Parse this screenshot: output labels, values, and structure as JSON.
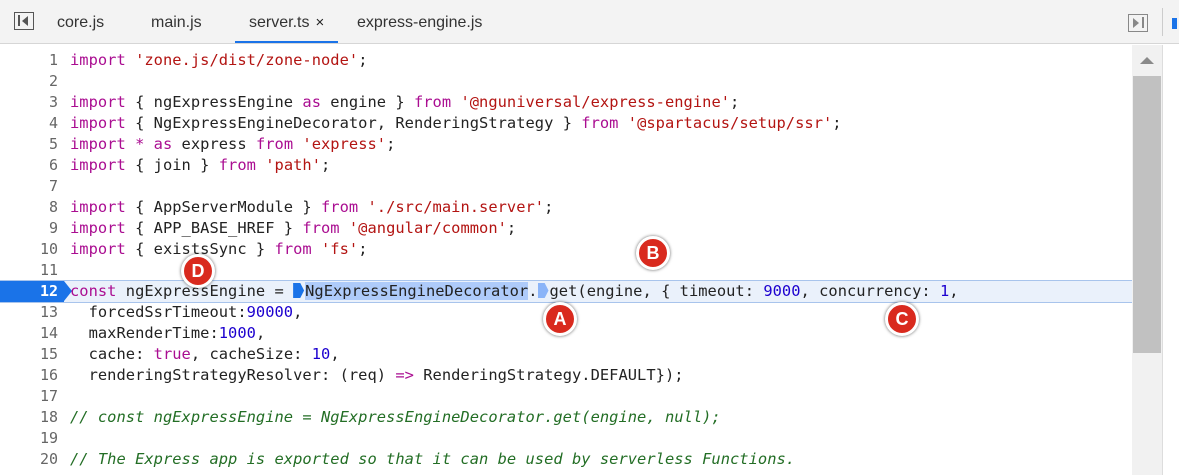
{
  "tabs": [
    {
      "label": "core.js"
    },
    {
      "label": "main.js"
    },
    {
      "label": "server.ts",
      "close": "×"
    },
    {
      "label": "express-engine.js"
    }
  ],
  "editor": {
    "current_line": 12,
    "lines": [
      {
        "num": "1",
        "text": "import 'zone.js/dist/zone-node';"
      },
      {
        "num": "2",
        "text": ""
      },
      {
        "num": "3",
        "text": "import { ngExpressEngine as engine } from '@nguniversal/express-engine';"
      },
      {
        "num": "4",
        "text": "import { NgExpressEngineDecorator, RenderingStrategy } from '@spartacus/setup/ssr';"
      },
      {
        "num": "5",
        "text": "import * as express from 'express';"
      },
      {
        "num": "6",
        "text": "import { join } from 'path';"
      },
      {
        "num": "7",
        "text": ""
      },
      {
        "num": "8",
        "text": "import { AppServerModule } from './src/main.server';"
      },
      {
        "num": "9",
        "text": "import { APP_BASE_HREF } from '@angular/common';"
      },
      {
        "num": "10",
        "text": "import { existsSync } from 'fs';"
      },
      {
        "num": "11",
        "text": ""
      },
      {
        "num": "12",
        "text": "const ngExpressEngine = NgExpressEngineDecorator.get(engine, { timeout: 9000, concurrency: 1,"
      },
      {
        "num": "13",
        "text": "  forcedSsrTimeout:90000,"
      },
      {
        "num": "14",
        "text": "  maxRenderTime:1000,"
      },
      {
        "num": "15",
        "text": "  cache: true, cacheSize: 10,"
      },
      {
        "num": "16",
        "text": "  renderingStrategyResolver: (req) => RenderingStrategy.DEFAULT});"
      },
      {
        "num": "17",
        "text": ""
      },
      {
        "num": "18",
        "text": "// const ngExpressEngine = NgExpressEngineDecorator.get(engine, null);"
      },
      {
        "num": "19",
        "text": ""
      },
      {
        "num": "20",
        "text": "// The Express app is exported so that it can be used by serverless Functions."
      }
    ]
  },
  "markers": {
    "a": "A",
    "b": "B",
    "c": "C",
    "d": "D"
  },
  "colors": {
    "accent": "#1a73e8",
    "keyword": "#aa0d91",
    "string": "#b31412",
    "number": "#1c00cf",
    "comment": "#236e25",
    "marker": "#d92a1e"
  },
  "icons": [
    "sidebar-toggle-icon",
    "close-icon",
    "breakpoint-icon",
    "scroll-up-icon",
    "panel-toggle-icon"
  ]
}
